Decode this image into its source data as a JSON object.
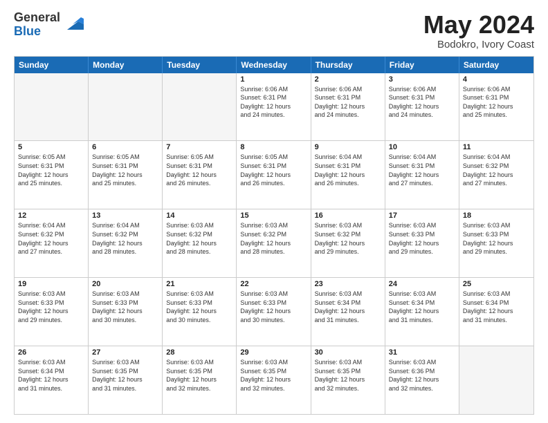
{
  "logo": {
    "general": "General",
    "blue": "Blue"
  },
  "title": {
    "month": "May 2024",
    "location": "Bodokro, Ivory Coast"
  },
  "days": [
    "Sunday",
    "Monday",
    "Tuesday",
    "Wednesday",
    "Thursday",
    "Friday",
    "Saturday"
  ],
  "weeks": [
    [
      {
        "day": "",
        "info": "",
        "empty": true
      },
      {
        "day": "",
        "info": "",
        "empty": true
      },
      {
        "day": "",
        "info": "",
        "empty": true
      },
      {
        "day": "1",
        "info": "Sunrise: 6:06 AM\nSunset: 6:31 PM\nDaylight: 12 hours\nand 24 minutes."
      },
      {
        "day": "2",
        "info": "Sunrise: 6:06 AM\nSunset: 6:31 PM\nDaylight: 12 hours\nand 24 minutes."
      },
      {
        "day": "3",
        "info": "Sunrise: 6:06 AM\nSunset: 6:31 PM\nDaylight: 12 hours\nand 24 minutes."
      },
      {
        "day": "4",
        "info": "Sunrise: 6:06 AM\nSunset: 6:31 PM\nDaylight: 12 hours\nand 25 minutes."
      }
    ],
    [
      {
        "day": "5",
        "info": "Sunrise: 6:05 AM\nSunset: 6:31 PM\nDaylight: 12 hours\nand 25 minutes."
      },
      {
        "day": "6",
        "info": "Sunrise: 6:05 AM\nSunset: 6:31 PM\nDaylight: 12 hours\nand 25 minutes."
      },
      {
        "day": "7",
        "info": "Sunrise: 6:05 AM\nSunset: 6:31 PM\nDaylight: 12 hours\nand 26 minutes."
      },
      {
        "day": "8",
        "info": "Sunrise: 6:05 AM\nSunset: 6:31 PM\nDaylight: 12 hours\nand 26 minutes."
      },
      {
        "day": "9",
        "info": "Sunrise: 6:04 AM\nSunset: 6:31 PM\nDaylight: 12 hours\nand 26 minutes."
      },
      {
        "day": "10",
        "info": "Sunrise: 6:04 AM\nSunset: 6:31 PM\nDaylight: 12 hours\nand 27 minutes."
      },
      {
        "day": "11",
        "info": "Sunrise: 6:04 AM\nSunset: 6:32 PM\nDaylight: 12 hours\nand 27 minutes."
      }
    ],
    [
      {
        "day": "12",
        "info": "Sunrise: 6:04 AM\nSunset: 6:32 PM\nDaylight: 12 hours\nand 27 minutes."
      },
      {
        "day": "13",
        "info": "Sunrise: 6:04 AM\nSunset: 6:32 PM\nDaylight: 12 hours\nand 28 minutes."
      },
      {
        "day": "14",
        "info": "Sunrise: 6:03 AM\nSunset: 6:32 PM\nDaylight: 12 hours\nand 28 minutes."
      },
      {
        "day": "15",
        "info": "Sunrise: 6:03 AM\nSunset: 6:32 PM\nDaylight: 12 hours\nand 28 minutes."
      },
      {
        "day": "16",
        "info": "Sunrise: 6:03 AM\nSunset: 6:32 PM\nDaylight: 12 hours\nand 29 minutes."
      },
      {
        "day": "17",
        "info": "Sunrise: 6:03 AM\nSunset: 6:33 PM\nDaylight: 12 hours\nand 29 minutes."
      },
      {
        "day": "18",
        "info": "Sunrise: 6:03 AM\nSunset: 6:33 PM\nDaylight: 12 hours\nand 29 minutes."
      }
    ],
    [
      {
        "day": "19",
        "info": "Sunrise: 6:03 AM\nSunset: 6:33 PM\nDaylight: 12 hours\nand 29 minutes."
      },
      {
        "day": "20",
        "info": "Sunrise: 6:03 AM\nSunset: 6:33 PM\nDaylight: 12 hours\nand 30 minutes."
      },
      {
        "day": "21",
        "info": "Sunrise: 6:03 AM\nSunset: 6:33 PM\nDaylight: 12 hours\nand 30 minutes."
      },
      {
        "day": "22",
        "info": "Sunrise: 6:03 AM\nSunset: 6:33 PM\nDaylight: 12 hours\nand 30 minutes."
      },
      {
        "day": "23",
        "info": "Sunrise: 6:03 AM\nSunset: 6:34 PM\nDaylight: 12 hours\nand 31 minutes."
      },
      {
        "day": "24",
        "info": "Sunrise: 6:03 AM\nSunset: 6:34 PM\nDaylight: 12 hours\nand 31 minutes."
      },
      {
        "day": "25",
        "info": "Sunrise: 6:03 AM\nSunset: 6:34 PM\nDaylight: 12 hours\nand 31 minutes."
      }
    ],
    [
      {
        "day": "26",
        "info": "Sunrise: 6:03 AM\nSunset: 6:34 PM\nDaylight: 12 hours\nand 31 minutes."
      },
      {
        "day": "27",
        "info": "Sunrise: 6:03 AM\nSunset: 6:35 PM\nDaylight: 12 hours\nand 31 minutes."
      },
      {
        "day": "28",
        "info": "Sunrise: 6:03 AM\nSunset: 6:35 PM\nDaylight: 12 hours\nand 32 minutes."
      },
      {
        "day": "29",
        "info": "Sunrise: 6:03 AM\nSunset: 6:35 PM\nDaylight: 12 hours\nand 32 minutes."
      },
      {
        "day": "30",
        "info": "Sunrise: 6:03 AM\nSunset: 6:35 PM\nDaylight: 12 hours\nand 32 minutes."
      },
      {
        "day": "31",
        "info": "Sunrise: 6:03 AM\nSunset: 6:36 PM\nDaylight: 12 hours\nand 32 minutes."
      },
      {
        "day": "",
        "info": "",
        "empty": true
      }
    ]
  ]
}
